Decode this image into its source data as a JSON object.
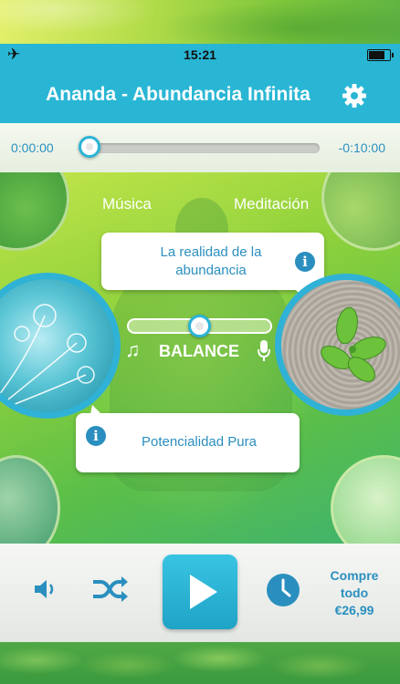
{
  "status_bar": {
    "time": "15:21",
    "airplane_mode_icon": "airplane-icon",
    "battery_level": 0.7
  },
  "nav": {
    "title": "Ananda - Abundancia Infinita",
    "settings_icon": "gear-icon"
  },
  "player": {
    "elapsed": "0:00:00",
    "remaining": "-0:10:00",
    "progress": 0.0
  },
  "mix": {
    "music_label": "Música",
    "meditation_label": "Meditación",
    "balance_label": "BALANCE",
    "balance_value": 0.5,
    "music_track": "La realidad de la abundancia",
    "meditation_track": "Potencialidad Pura",
    "info_icon_glyph": "i"
  },
  "controls": {
    "volume_icon": "speaker-icon",
    "shuffle_icon": "shuffle-icon",
    "play_icon": "play-icon",
    "timer_icon": "clock-icon",
    "buy_line1": "Compre",
    "buy_line2": "todo",
    "buy_price": "€26,99"
  },
  "colors": {
    "accent": "#29b6d4",
    "text_blue": "#2a8fbf"
  }
}
